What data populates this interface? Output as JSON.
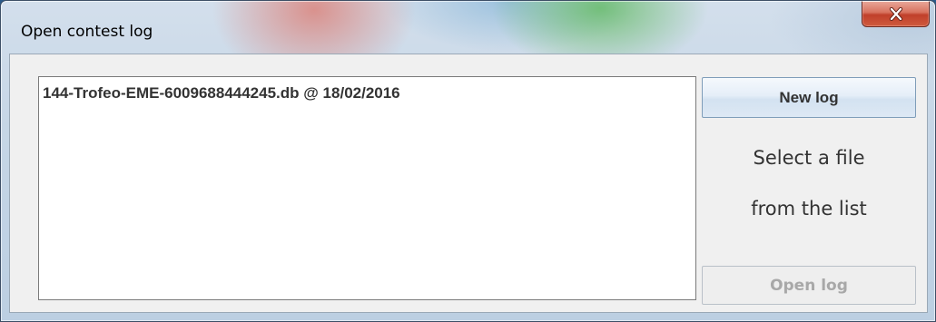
{
  "window": {
    "title": "Open contest log",
    "close_icon": "close-icon"
  },
  "file_list": {
    "items": [
      {
        "label": "144-Trofeo-EME-6009688444245.db @ 18/02/2016"
      }
    ]
  },
  "actions": {
    "new_log_label": "New log",
    "open_log_label": "Open log",
    "open_log_enabled": false
  },
  "hint": {
    "line1": "Select a file",
    "line2": "from the list"
  }
}
